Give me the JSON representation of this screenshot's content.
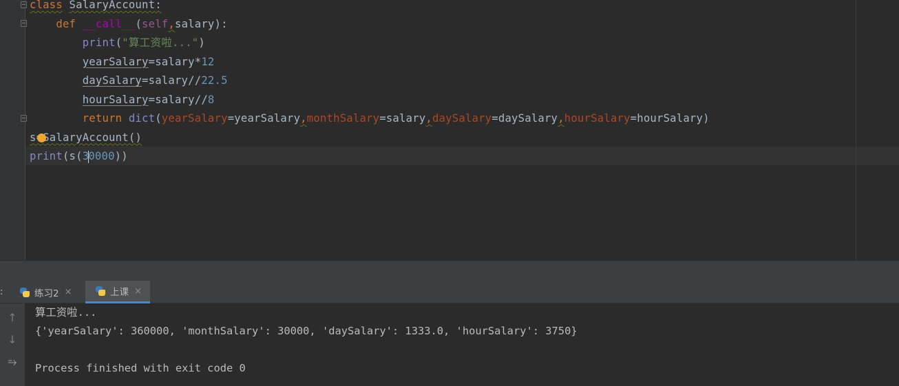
{
  "editor": {
    "lines": [
      {
        "tokens": [
          {
            "t": "class",
            "c": "kw wavy"
          },
          {
            "t": " "
          },
          {
            "t": "SalaryAccount",
            "c": "cls wavy"
          },
          {
            "t": ":",
            "c": "wavy"
          }
        ]
      },
      {
        "tokens": [
          {
            "t": "    "
          },
          {
            "t": "def",
            "c": "kw"
          },
          {
            "t": " "
          },
          {
            "t": "__call__",
            "c": "dunder"
          },
          {
            "t": "("
          },
          {
            "t": "self",
            "c": "self"
          },
          {
            "t": ",",
            "c": "comma wavy"
          },
          {
            "t": "salary"
          },
          {
            "t": "):"
          }
        ]
      },
      {
        "tokens": [
          {
            "t": "        "
          },
          {
            "t": "print",
            "c": "bi"
          },
          {
            "t": "("
          },
          {
            "t": "\"算工资啦...\"",
            "c": "str"
          },
          {
            "t": ")"
          }
        ]
      },
      {
        "tokens": [
          {
            "t": "        "
          },
          {
            "t": "yearSalary",
            "c": "uline"
          },
          {
            "t": "=salary*"
          },
          {
            "t": "12",
            "c": "num"
          }
        ]
      },
      {
        "tokens": [
          {
            "t": "        "
          },
          {
            "t": "daySalary",
            "c": "uline"
          },
          {
            "t": "=salary//"
          },
          {
            "t": "22.5",
            "c": "num"
          }
        ]
      },
      {
        "tokens": [
          {
            "t": "        "
          },
          {
            "t": "hourSalary",
            "c": "uline"
          },
          {
            "t": "=salary//"
          },
          {
            "t": "8",
            "c": "num"
          }
        ]
      },
      {
        "tokens": [
          {
            "t": "        "
          },
          {
            "t": "return",
            "c": "kw"
          },
          {
            "t": " "
          },
          {
            "t": "dict",
            "c": "bi"
          },
          {
            "t": "("
          },
          {
            "t": "yearSalary",
            "c": "param"
          },
          {
            "t": "=yearSalary"
          },
          {
            "t": ",",
            "c": "comma wavy"
          },
          {
            "t": "monthSalary",
            "c": "param"
          },
          {
            "t": "=salary"
          },
          {
            "t": ",",
            "c": "comma wavy"
          },
          {
            "t": "daySalary",
            "c": "param"
          },
          {
            "t": "=daySalary"
          },
          {
            "t": ",",
            "c": "comma wavy"
          },
          {
            "t": "hourSalary",
            "c": "param"
          },
          {
            "t": "=hourSalary)"
          }
        ]
      },
      {
        "tokens": [
          {
            "t": "s=SalaryAccount()",
            "c": "wavy"
          }
        ]
      },
      {
        "tokens": [
          {
            "t": "print",
            "c": "bi"
          },
          {
            "t": "(s("
          },
          {
            "t": "3",
            "c": "num"
          },
          {
            "t": "|",
            "c": "caret"
          },
          {
            "t": "0000",
            "c": "num"
          },
          {
            "t": "))"
          }
        ]
      }
    ]
  },
  "run_panel": {
    "tab_colon": ":",
    "tabs": [
      {
        "label": "练习2",
        "active": false
      },
      {
        "label": "上课",
        "active": true
      }
    ],
    "output": [
      "算工资啦...",
      "{'yearSalary': 360000, 'monthSalary': 30000, 'daySalary': 1333.0, 'hourSalary': 3750}",
      "",
      "Process finished with exit code 0"
    ]
  },
  "icons": {
    "close": "×",
    "up_arrow": "↑",
    "down_arrow": "↓",
    "wrap": "⥱"
  }
}
